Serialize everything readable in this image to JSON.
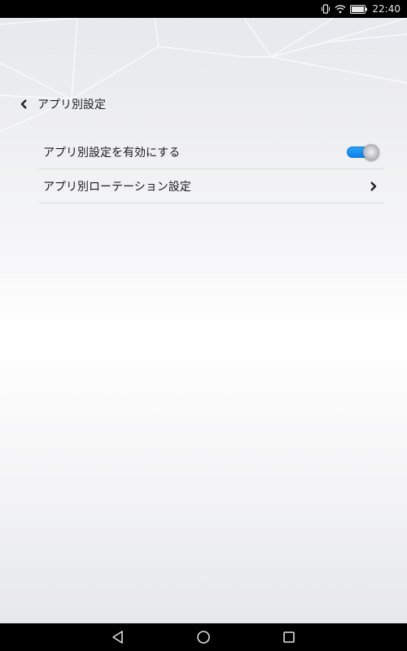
{
  "status_bar": {
    "time": "22:40",
    "icons": [
      "vibrate-icon",
      "wifi-icon",
      "battery-icon"
    ]
  },
  "header": {
    "back_icon": "chevron-left-icon",
    "title": "アプリ別設定"
  },
  "settings": {
    "items": [
      {
        "label": "アプリ別設定を有効にする",
        "control": "toggle",
        "state": "on"
      },
      {
        "label": "アプリ別ローテーション設定",
        "control": "chevron-right-icon"
      }
    ]
  },
  "nav_bar": {
    "icons": [
      "back-triangle-icon",
      "home-circle-icon",
      "recents-square-icon"
    ]
  },
  "colors": {
    "toggle_on": "#1a90f2",
    "text": "#1c1c1c",
    "divider": "#dcdcde"
  }
}
